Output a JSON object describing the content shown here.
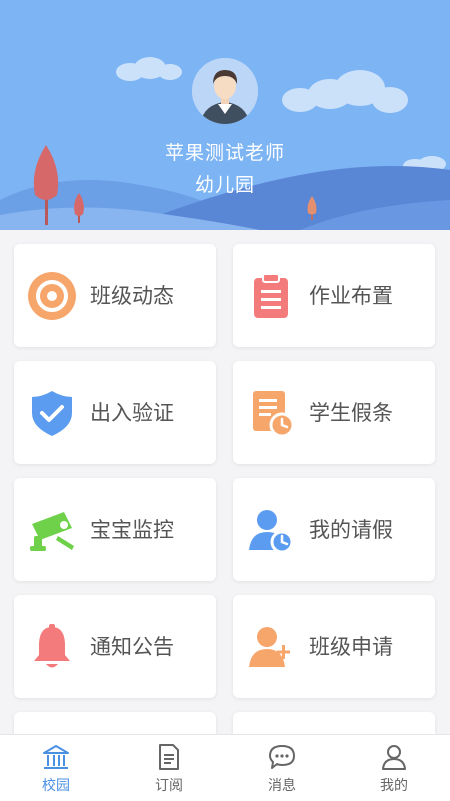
{
  "profile": {
    "teacher_name": "苹果测试老师",
    "school_name": "幼儿园"
  },
  "menu": [
    {
      "label": "班级动态",
      "icon": "target-icon",
      "color": "#f7a66b"
    },
    {
      "label": "作业布置",
      "icon": "clipboard-icon",
      "color": "#f47b7b"
    },
    {
      "label": "出入验证",
      "icon": "shield-check-icon",
      "color": "#5b9cf0"
    },
    {
      "label": "学生假条",
      "icon": "document-clock-icon",
      "color": "#f7a66b"
    },
    {
      "label": "宝宝监控",
      "icon": "camera-icon",
      "color": "#6fd04a"
    },
    {
      "label": "我的请假",
      "icon": "user-clock-icon",
      "color": "#5b9cf0"
    },
    {
      "label": "通知公告",
      "icon": "bell-icon",
      "color": "#f47b7b"
    },
    {
      "label": "班级申请",
      "icon": "user-add-icon",
      "color": "#f7a66b"
    }
  ],
  "tabs": [
    {
      "label": "校园",
      "icon": "school-icon",
      "active": true
    },
    {
      "label": "订阅",
      "icon": "document-icon",
      "active": false
    },
    {
      "label": "消息",
      "icon": "chat-icon",
      "active": false
    },
    {
      "label": "我的",
      "icon": "user-icon",
      "active": false
    }
  ],
  "colors": {
    "accent": "#4a90e2",
    "header_bg": "#7db4f4"
  }
}
